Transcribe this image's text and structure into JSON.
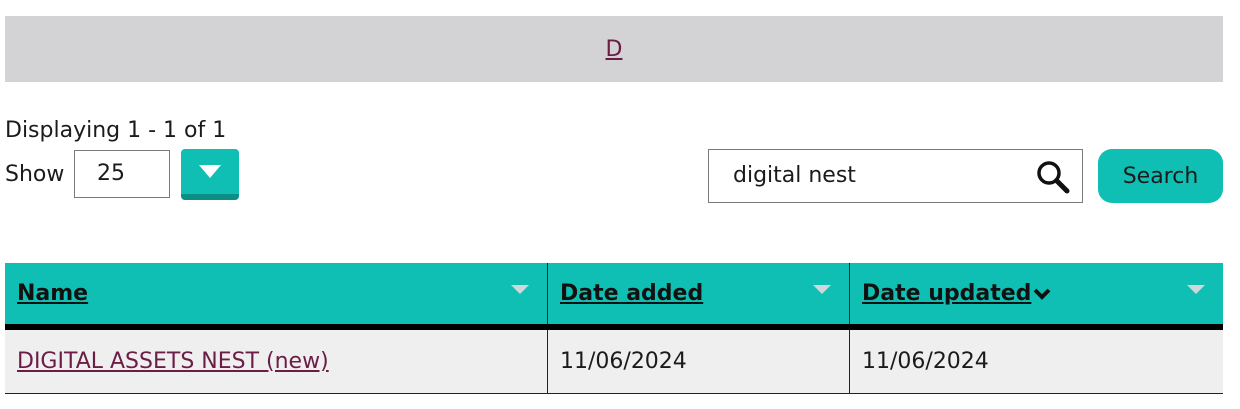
{
  "alpha_nav": {
    "letter": "D"
  },
  "pager": {
    "displaying": "Displaying 1 - 1 of 1",
    "show_label": "Show",
    "show_value": "25"
  },
  "search": {
    "value": "digital nest",
    "button_label": "Search"
  },
  "table": {
    "headers": [
      "Name",
      "Date added",
      "Date updated"
    ],
    "rows": [
      {
        "name": "DIGITAL ASSETS NEST (new)",
        "date_added": "11/06/2024",
        "date_updated": "11/06/2024"
      }
    ]
  },
  "icons": {
    "dropdown": "chevron-down-icon",
    "search": "search-icon",
    "sort_active": "chevron-down-icon",
    "sort_inactive": "sort-triangle-icon"
  },
  "colors": {
    "accent": "#0fbfb3",
    "link": "#6b1d45",
    "letter_bar": "#d3d3d5"
  }
}
